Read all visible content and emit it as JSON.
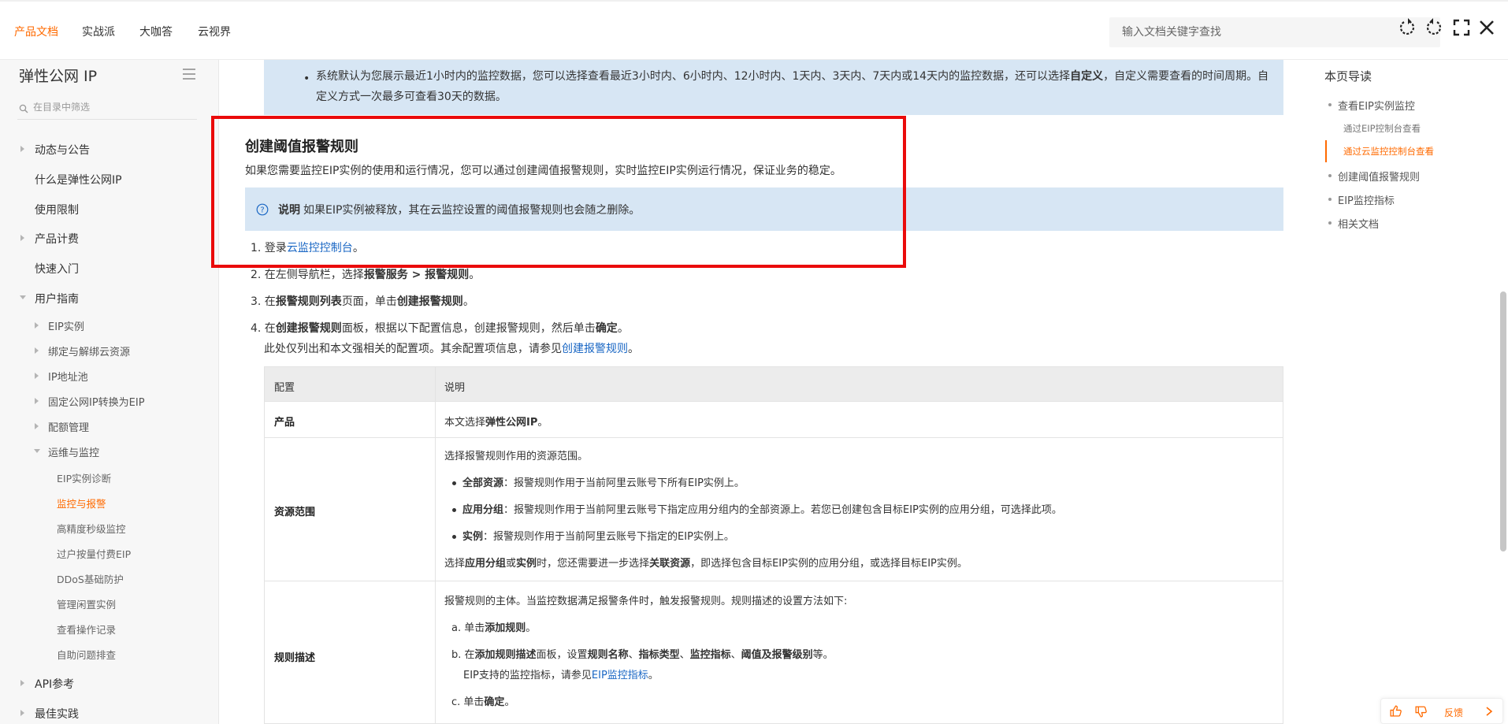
{
  "topnav": {
    "items": [
      "产品文档",
      "实战派",
      "大咖答",
      "云视界"
    ],
    "search_placeholder": "输入文档关键字查找"
  },
  "sidebar": {
    "title": "弹性公网 IP",
    "filter_placeholder": "在目录中筛选",
    "items": [
      {
        "label": "动态与公告"
      },
      {
        "label": "什么是弹性公网IP"
      },
      {
        "label": "使用限制"
      },
      {
        "label": "产品计费"
      },
      {
        "label": "快速入门"
      },
      {
        "label": "用户指南"
      },
      {
        "label": "EIP实例"
      },
      {
        "label": "绑定与解绑云资源"
      },
      {
        "label": "IP地址池"
      },
      {
        "label": "固定公网IP转换为EIP"
      },
      {
        "label": "配额管理"
      },
      {
        "label": "运维与监控"
      },
      {
        "label": "EIP实例诊断"
      },
      {
        "label": "监控与报警"
      },
      {
        "label": "高精度秒级监控"
      },
      {
        "label": "过户按量付费EIP"
      },
      {
        "label": "DDoS基础防护"
      },
      {
        "label": "管理闲置实例"
      },
      {
        "label": "查看操作记录"
      },
      {
        "label": "自助问题排查"
      },
      {
        "label": "API参考"
      },
      {
        "label": "最佳实践"
      }
    ]
  },
  "main": {
    "top_note_a": "系统默认为您展示最近1小时内的监控数据，您可以选择查看最近3小时内、6小时内、12小时内、1天内、3天内、7天内或14天内的监控数据，还可以选择",
    "top_note_bold": "自定义",
    "top_note_b": "，自定义需要查看的时间周期。自定义方式一次最多可查看30天的数据。",
    "heading": "创建阈值报警规则",
    "intro": "如果您需要监控EIP实例的使用和运行情况，您可以通过创建阈值报警规则，实时监控EIP实例运行情况，保证业务的稳定。",
    "note_label": "说明",
    "note_text": "如果EIP实例被释放，其在云监控设置的阈值报警规则也会随之删除。",
    "steps": {
      "s1_pre": "1. 登录",
      "s1_link": "云监控控制台",
      "s1_post": "。",
      "s2_pre": "2. 在左侧导航栏，选择",
      "s2_b1": "报警服务",
      "s2_mid": " > ",
      "s2_b2": "报警规则",
      "s2_post": "。",
      "s3_pre": "3. 在",
      "s3_b1": "报警规则列表",
      "s3_mid": "页面，单击",
      "s3_b2": "创建报警规则",
      "s3_post": "。",
      "s4_pre": "4. 在",
      "s4_b1": "创建报警规则",
      "s4_mid": "面板，根据以下配置信息，创建报警规则，然后单击",
      "s4_b2": "确定",
      "s4_post": "。",
      "s4_sub_pre": "此处仅列出和本文强相关的配置项。其余配置项信息，请参见",
      "s4_sub_link": "创建报警规则",
      "s4_sub_post": "。"
    },
    "table": {
      "headers": [
        "配置",
        "说明"
      ],
      "product_label": "产品",
      "product_pre": "本文选择",
      "product_bold": "弹性公网IP",
      "product_post": "。",
      "scope_label": "资源范围",
      "scope_lead": "选择报警规则作用的资源范围。",
      "scope_b1": "全部资源",
      "scope_t1": "：报警规则作用于当前阿里云账号下所有EIP实例上。",
      "scope_b2": "应用分组",
      "scope_t2": "：报警规则作用于当前阿里云账号下指定应用分组内的全部资源上。若您已创建包含目标EIP实例的应用分组，可选择此项。",
      "scope_b3": "实例",
      "scope_t3": "：报警规则作用于当前阿里云账号下指定的EIP实例上。",
      "scope_tail_1": "选择",
      "scope_tail_b1": "应用分组",
      "scope_tail_2": "或",
      "scope_tail_b2": "实例",
      "scope_tail_3": "时，您还需要进一步选择",
      "scope_tail_b3": "关联资源",
      "scope_tail_4": "，即选择包含目标EIP实例的应用分组，或选择目标EIP实例。",
      "rule_label": "规则描述",
      "rule_lead": "报警规则的主体。当监控数据满足报警条件时，触发报警规则。规则描述的设置方法如下:",
      "rule_a_pre": "a. 单击",
      "rule_a_b": "添加规则",
      "rule_a_post": "。",
      "rule_b_pre": "b. 在",
      "rule_b_b1": "添加规则描述",
      "rule_b_m1": "面板，设置",
      "rule_b_b2": "规则名称",
      "rule_b_s1": "、",
      "rule_b_b3": "指标类型",
      "rule_b_s2": "、",
      "rule_b_b4": "监控指标",
      "rule_b_s3": "、",
      "rule_b_b5": "阈值及报警级别",
      "rule_b_post": "等。",
      "rule_b_sub_pre": "EIP支持的监控指标，请参见",
      "rule_b_sub_link": "EIP监控指标",
      "rule_b_sub_post": "。",
      "rule_c_pre": "c. 单击",
      "rule_c_b": "确定",
      "rule_c_post": "。"
    }
  },
  "toc": {
    "title": "本页导读",
    "items": [
      {
        "label": "查看EIP实例监控"
      },
      {
        "label": "通过EIP控制台查看"
      },
      {
        "label": "通过云监控控制台查看"
      },
      {
        "label": "创建阈值报警规则"
      },
      {
        "label": "EIP监控指标"
      },
      {
        "label": "相关文档"
      }
    ]
  },
  "feedback": {
    "label": "反馈"
  },
  "colors": {
    "accent": "#ff6a00",
    "link": "#1a67c4",
    "info_bg": "#d7e6f4",
    "highlight": "#ea0b0b"
  }
}
